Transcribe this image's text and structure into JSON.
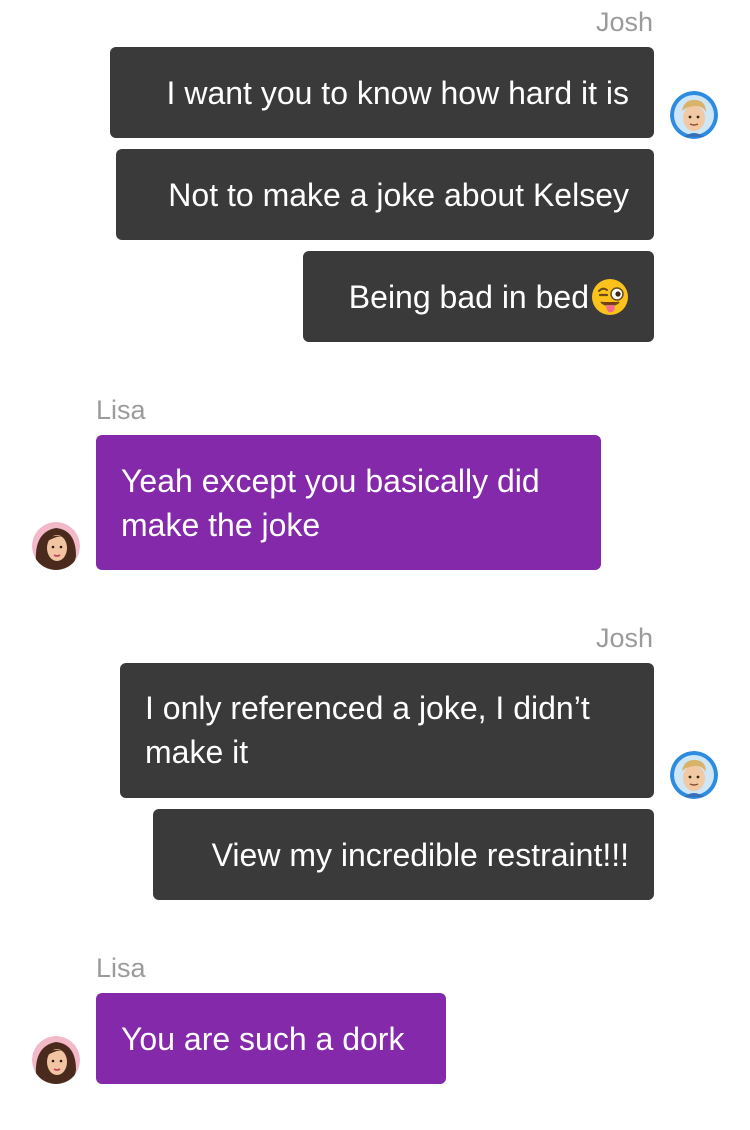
{
  "conversation": {
    "groups": [
      {
        "sender": "Josh",
        "messages": [
          "I want you to know how hard it is",
          "Not to make a joke about Kelsey",
          "Being bad in bed"
        ],
        "avatar_icon": "josh-avatar-icon",
        "trailing_emoji": "winking-face-with-tongue-icon"
      },
      {
        "sender": "Lisa",
        "messages": [
          "Yeah except you basically did make the joke"
        ],
        "avatar_icon": "lisa-avatar-icon"
      },
      {
        "sender": "Josh",
        "messages": [
          "I only referenced a joke, I didn’t make it",
          "View my incredible restraint!!!"
        ],
        "avatar_icon": "josh-avatar-icon"
      },
      {
        "sender": "Lisa",
        "messages": [
          "You are such a dork"
        ],
        "avatar_icon": "lisa-avatar-icon"
      }
    ]
  },
  "colors": {
    "outgoing_bubble": "#3a3a3a",
    "incoming_bubble": "#8429aa",
    "sender_label": "#9b9b9b",
    "bubble_text": "#ffffff"
  }
}
